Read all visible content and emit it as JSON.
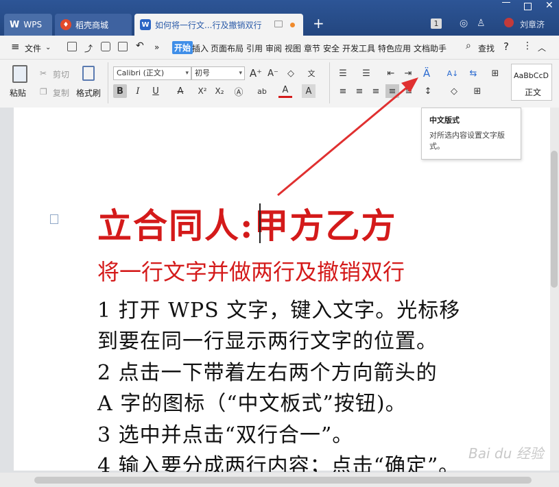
{
  "titlebar": {
    "tabs": [
      {
        "label": "WPS",
        "icon": "wps-logo-icon"
      },
      {
        "label": "稻壳商城",
        "icon": "docer-flame-icon"
      },
      {
        "label": "如何将一行文...行及撤销双行",
        "icon": "writer-doc-icon"
      }
    ],
    "new_tab": "+",
    "badge": "1",
    "user_name": "刘章济"
  },
  "menubar": {
    "file": "文件",
    "more": "»",
    "tabs": [
      "开始",
      "插入",
      "页面布局",
      "引用",
      "审阅",
      "视图",
      "章节",
      "安全",
      "开发工具",
      "特色应用",
      "文档助手"
    ],
    "search": "查找",
    "help": "?"
  },
  "ribbon": {
    "paste": "粘贴",
    "cut": "剪切",
    "copy": "复制",
    "format_painter": "格式刷",
    "font_name": "Calibri (正文)",
    "font_size": "初号",
    "bold": "B",
    "italic": "I",
    "underline": "U",
    "strike": "A",
    "superscript": "X²",
    "subscript": "X₂",
    "font_color": "A",
    "style_preview": "AaBbCcD",
    "style_name": "正文"
  },
  "tooltip": {
    "title": "中文版式",
    "description": "对所选内容设置文字版式。"
  },
  "document": {
    "title_line": "立合同人:甲方乙方",
    "subtitle_line": "将一行文字并做两行及撤销双行",
    "lines": [
      "1 打开 WPS 文字，键入文字。光标移",
      "到要在同一行显示两行文字的位置。",
      "2 点击一下带着左右两个方向箭头的",
      "A 字的图标（“中文板式”按钮)。",
      "3 选中并点击“双行合一”。",
      "4 输入要分成两行内容；点击“确定”。"
    ]
  },
  "watermark": "Bai du 经验",
  "colors": {
    "titlebar": "#2a4e8c",
    "accent": "#3f8ee8",
    "heading_red": "#d41a1a",
    "arrow_red": "#e03030"
  }
}
